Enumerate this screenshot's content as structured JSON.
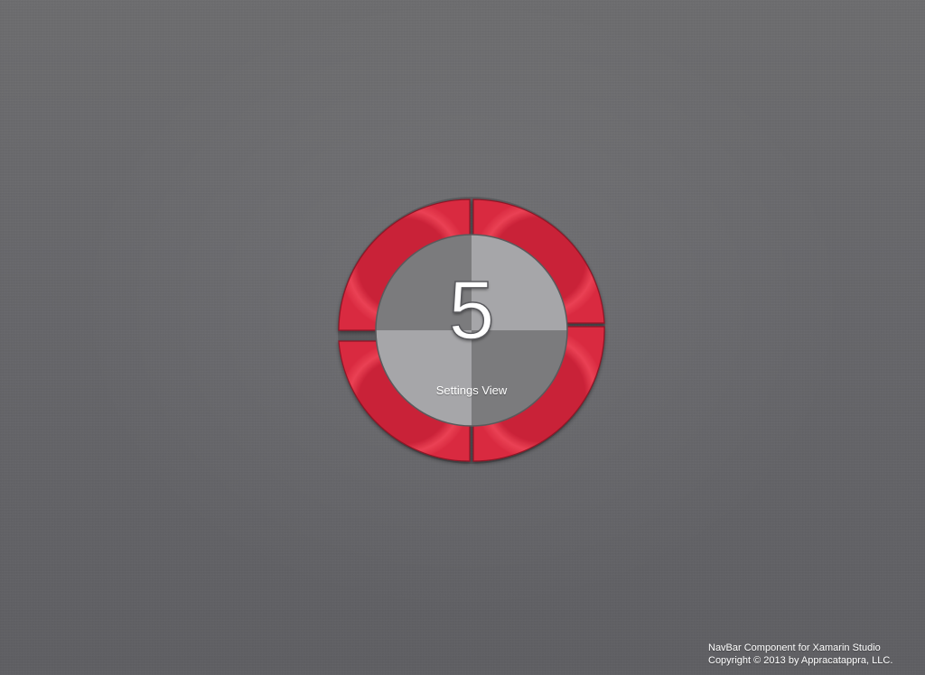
{
  "navbar": {
    "number": "5",
    "title": "Settings View"
  },
  "footer": {
    "line1": "NavBar Component for Xamarin Studio",
    "line2": "Copyright © 2013 by Appracatappra, LLC."
  },
  "colors": {
    "ring": "#e8384f",
    "ring_dark": "#b91f33",
    "quad_light": "#a5a5a8",
    "quad_dark": "#7a7a7c",
    "background": "#67676b"
  }
}
